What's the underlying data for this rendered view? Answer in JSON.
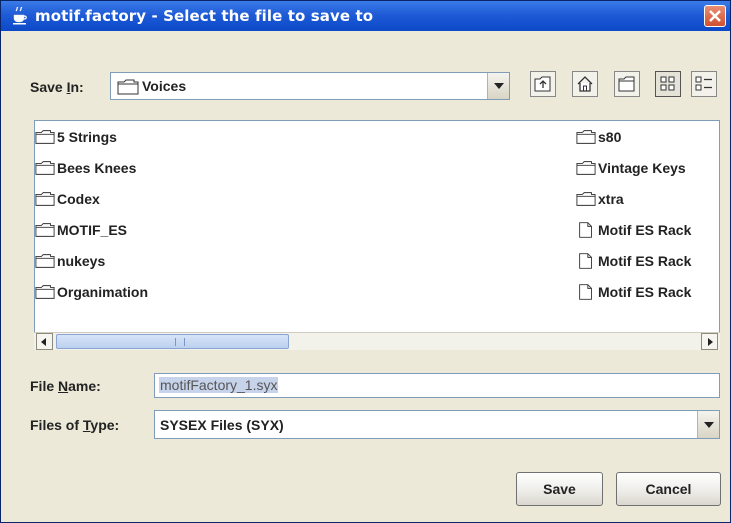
{
  "window": {
    "title": "motif.factory - Select the file to save to"
  },
  "save_in": {
    "label_pre": "Save ",
    "label_mnemonic": "I",
    "label_post": "n:",
    "value": "Voices"
  },
  "files": {
    "col1": [
      {
        "name": "5 Strings",
        "type": "folder"
      },
      {
        "name": "Bees Knees",
        "type": "folder"
      },
      {
        "name": "Codex",
        "type": "folder"
      },
      {
        "name": "MOTIF_ES",
        "type": "folder"
      },
      {
        "name": "nukeys",
        "type": "folder"
      },
      {
        "name": "Organimation",
        "type": "folder"
      }
    ],
    "col2": [
      {
        "name": "s80",
        "type": "folder"
      },
      {
        "name": "Vintage Keys",
        "type": "folder"
      },
      {
        "name": "xtra",
        "type": "folder"
      },
      {
        "name": "Motif ES Rack",
        "type": "file"
      },
      {
        "name": "Motif ES Rack",
        "type": "file"
      },
      {
        "name": "Motif ES Rack",
        "type": "file"
      }
    ]
  },
  "file_name": {
    "label_pre": "File ",
    "label_mnemonic": "N",
    "label_post": "ame:",
    "value": "motifFactory_1.syx"
  },
  "file_type": {
    "label_pre": "Files of ",
    "label_mnemonic": "T",
    "label_post": "ype:",
    "value": "SYSEX Files (SYX)"
  },
  "buttons": {
    "save": "Save",
    "cancel": "Cancel"
  },
  "icons": {
    "title": "java-cup-icon",
    "close": "close-icon",
    "up": "up-one-level-icon",
    "home": "home-icon",
    "new_folder": "new-folder-icon",
    "list": "list-view-icon",
    "details": "details-view-icon"
  }
}
